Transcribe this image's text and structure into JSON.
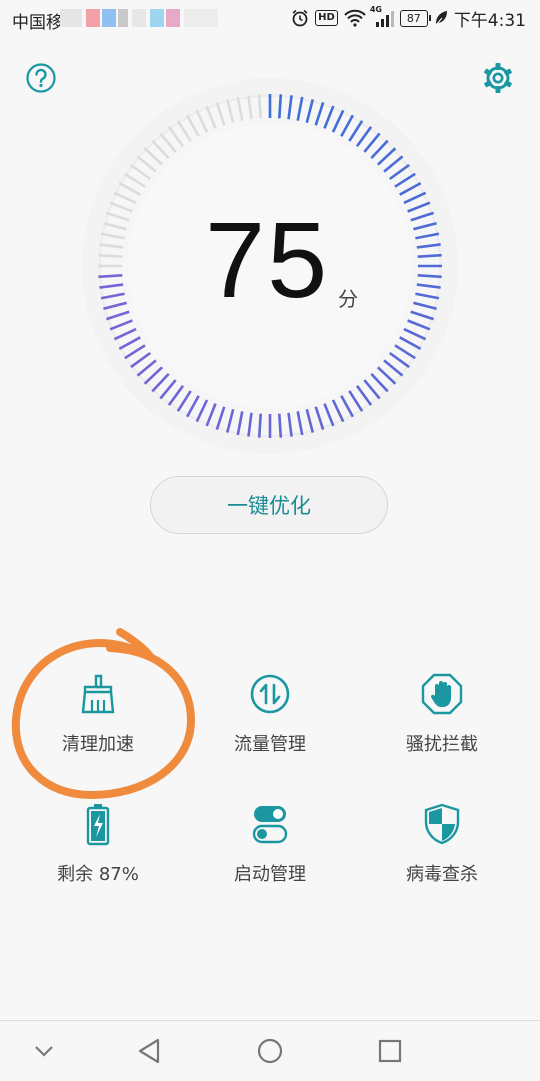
{
  "status_bar": {
    "carrier": "中国移",
    "hd": "HD",
    "network": "4G",
    "battery": "87",
    "time": "下午4:31"
  },
  "gauge": {
    "score": "75",
    "unit": "分",
    "progress": 0.75
  },
  "actions": {
    "optimize_label": "一键优化"
  },
  "tools": [
    {
      "label": "清理加速",
      "icon": "broom-icon"
    },
    {
      "label": "流量管理",
      "icon": "data-traffic-icon"
    },
    {
      "label": "骚扰拦截",
      "icon": "hand-block-icon"
    },
    {
      "label": "剩余 87%",
      "icon": "battery-charging-icon"
    },
    {
      "label": "启动管理",
      "icon": "toggle-icon"
    },
    {
      "label": "病毒查杀",
      "icon": "shield-icon"
    }
  ],
  "colors": {
    "accent": "#1a97a0",
    "gauge_blue": "#3d6fd6",
    "gauge_purple": "#7b63d6",
    "annotation": "#f08a3c"
  }
}
